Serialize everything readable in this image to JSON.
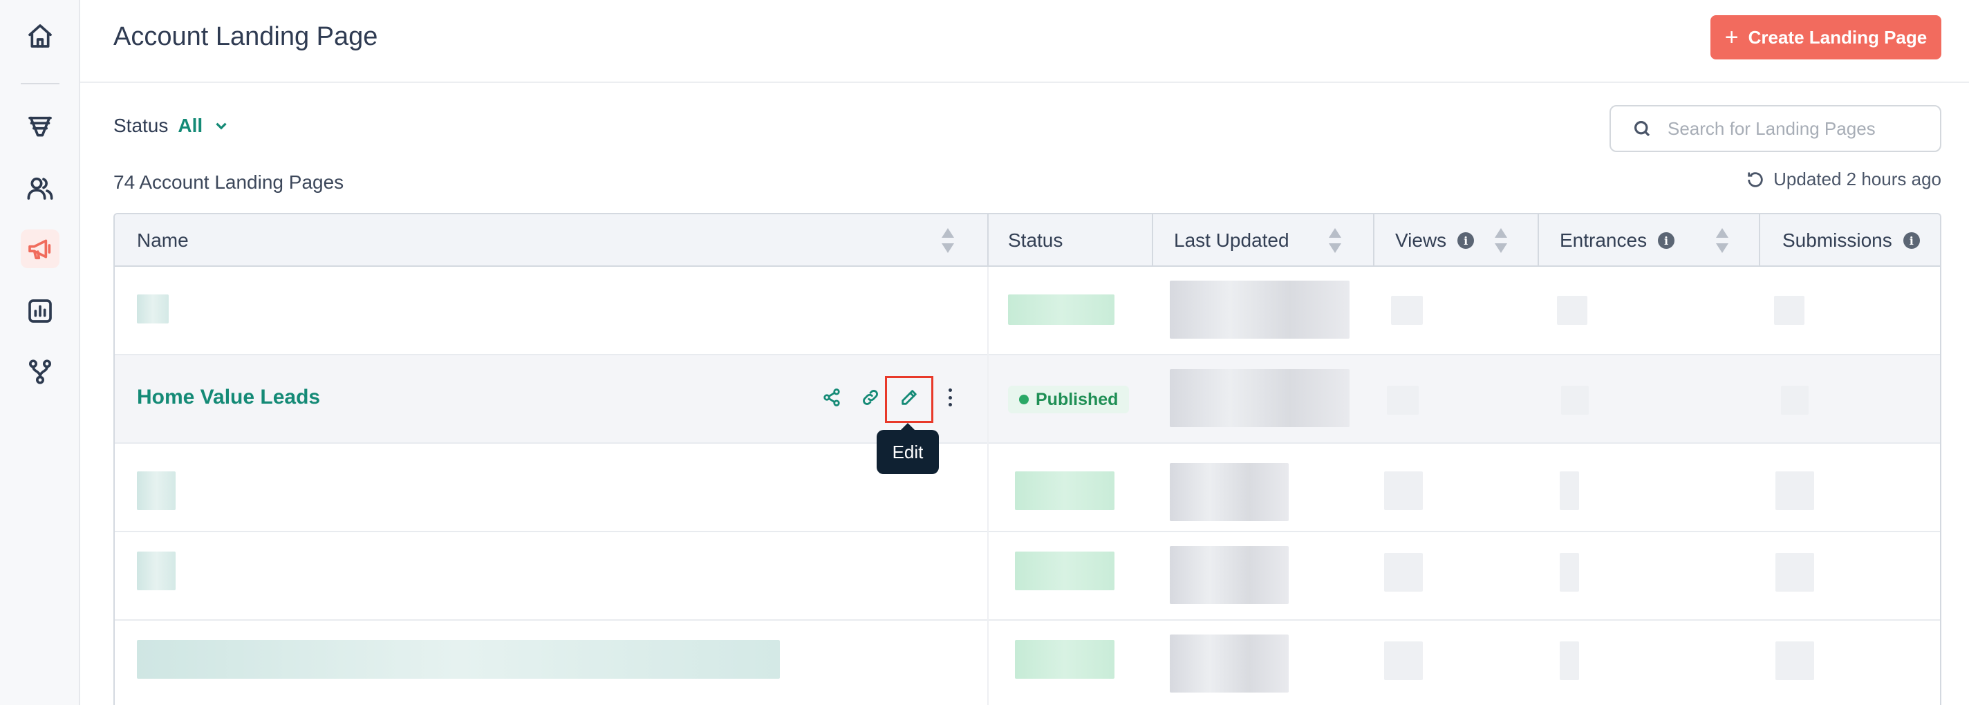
{
  "header": {
    "title": "Account Landing Page",
    "create_button": "Create Landing Page"
  },
  "sidebar": {
    "items": [
      {
        "icon": "home-icon",
        "active": false
      },
      {
        "icon": "funnel-icon",
        "active": false
      },
      {
        "icon": "users-icon",
        "active": false
      },
      {
        "icon": "megaphone-icon",
        "active": true
      },
      {
        "icon": "chart-icon",
        "active": false
      },
      {
        "icon": "workflow-icon",
        "active": false
      }
    ]
  },
  "filter": {
    "label": "Status",
    "value": "All"
  },
  "search": {
    "placeholder": "Search for Landing Pages"
  },
  "summary": {
    "count_text": "74 Account Landing Pages",
    "updated_text": "Updated 2 hours ago"
  },
  "table": {
    "columns": [
      "Name",
      "Status",
      "Last Updated",
      "Views",
      "Entrances",
      "Submissions"
    ],
    "highlighted_row": {
      "name": "Home Value Leads",
      "status": "Published"
    }
  },
  "tooltip": {
    "text": "Edit"
  },
  "colors": {
    "accent": "#148a76",
    "primary_button": "#f26b5e",
    "highlight_box": "#e8392a",
    "published": "#1f8f55"
  }
}
